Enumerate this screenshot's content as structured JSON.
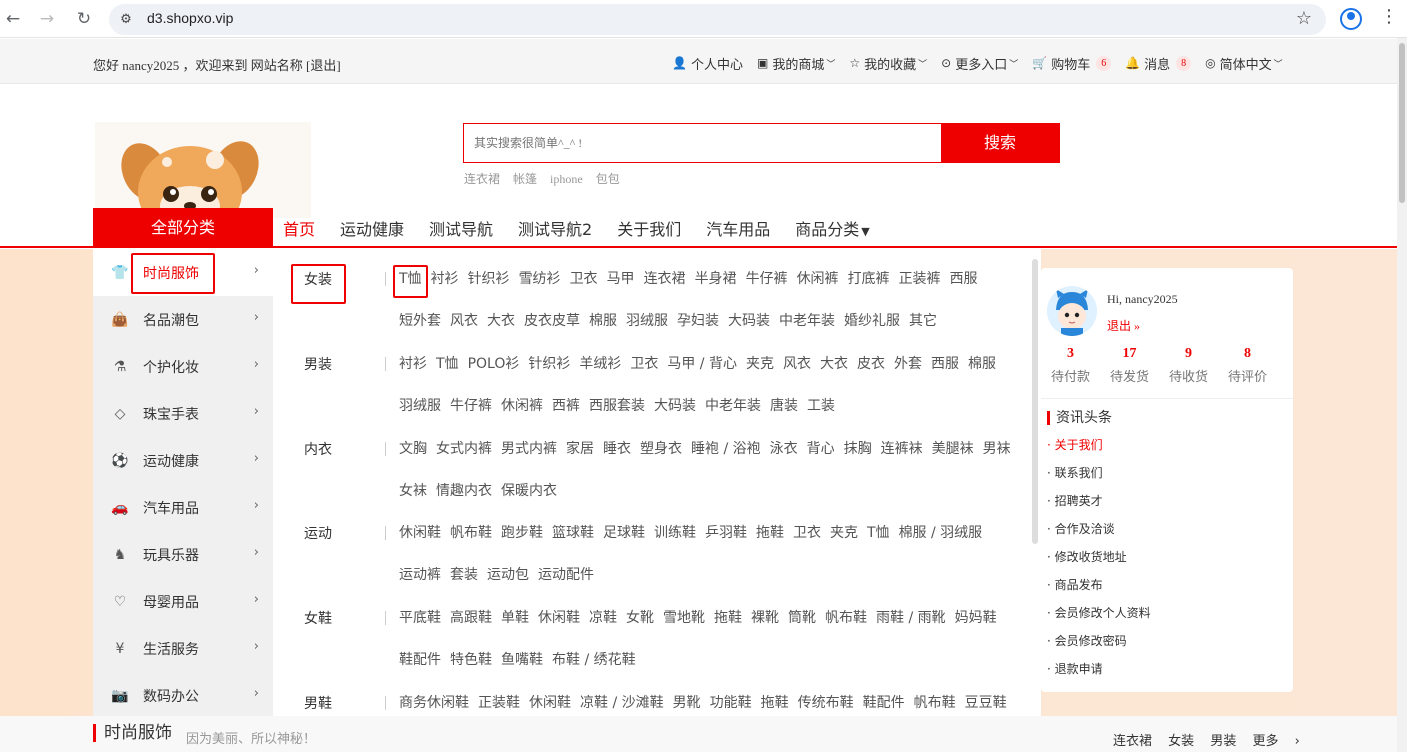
{
  "browser": {
    "url": "d3.shopxo.vip"
  },
  "topbar": {
    "greeting": "您好 nancy2025 ，欢迎来到 网站名称 [退出]",
    "links": [
      {
        "label": "个人中心",
        "icon": "user-icon",
        "caret": false
      },
      {
        "label": "我的商城",
        "icon": "shop-icon",
        "caret": true
      },
      {
        "label": "我的收藏",
        "icon": "star-icon",
        "caret": true
      },
      {
        "label": "更多入口",
        "icon": "more-icon",
        "caret": true
      },
      {
        "label": "购物车",
        "icon": "cart-icon",
        "caret": false,
        "badge": "6"
      },
      {
        "label": "消息",
        "icon": "bell-icon",
        "caret": false,
        "badge": "8"
      },
      {
        "label": "简体中文",
        "icon": "language-icon",
        "caret": true
      }
    ]
  },
  "search": {
    "placeholder": "其实搜索很简单^_^ !",
    "button": "搜索",
    "hot_words": [
      "连衣裙",
      "帐篷",
      "iphone",
      "包包"
    ]
  },
  "nav": {
    "all_categories": "全部分类",
    "items": [
      "首页",
      "运动健康",
      "测试导航",
      "测试导航2",
      "关于我们",
      "汽车用品",
      "商品分类"
    ],
    "active": "首页"
  },
  "sidebar": {
    "items": [
      {
        "label": "时尚服饰",
        "icon": "shirt-icon"
      },
      {
        "label": "名品潮包",
        "icon": "bag-icon"
      },
      {
        "label": "个护化妆",
        "icon": "cosmetics-icon"
      },
      {
        "label": "珠宝手表",
        "icon": "diamond-icon"
      },
      {
        "label": "运动健康",
        "icon": "sport-icon"
      },
      {
        "label": "汽车用品",
        "icon": "car-icon"
      },
      {
        "label": "玩具乐器",
        "icon": "toy-icon"
      },
      {
        "label": "母婴用品",
        "icon": "baby-icon"
      },
      {
        "label": "生活服务",
        "icon": "service-icon"
      },
      {
        "label": "数码办公",
        "icon": "camera-icon"
      }
    ]
  },
  "megamenu": {
    "rows": [
      {
        "label": "女装",
        "items": [
          "T恤",
          "衬衫",
          "针织衫",
          "雪纺衫",
          "卫衣",
          "马甲",
          "连衣裙",
          "半身裙",
          "牛仔裤",
          "休闲裤",
          "打底裤",
          "正装裤",
          "西服",
          "短外套",
          "风衣",
          "大衣",
          "皮衣皮草",
          "棉服",
          "羽绒服",
          "孕妇装",
          "大码装",
          "中老年装",
          "婚纱礼服",
          "其它"
        ]
      },
      {
        "label": "男装",
        "items": [
          "衬衫",
          "T恤",
          "POLO衫",
          "针织衫",
          "羊绒衫",
          "卫衣",
          "马甲 / 背心",
          "夹克",
          "风衣",
          "大衣",
          "皮衣",
          "外套",
          "西服",
          "棉服",
          "羽绒服",
          "牛仔裤",
          "休闲裤",
          "西裤",
          "西服套装",
          "大码装",
          "中老年装",
          "唐装",
          "工装"
        ]
      },
      {
        "label": "内衣",
        "items": [
          "文胸",
          "女式内裤",
          "男式内裤",
          "家居",
          "睡衣",
          "塑身衣",
          "睡袍 / 浴袍",
          "泳衣",
          "背心",
          "抹胸",
          "连裤袜",
          "美腿袜",
          "男袜",
          "女袜",
          "情趣内衣",
          "保暖内衣"
        ]
      },
      {
        "label": "运动",
        "items": [
          "休闲鞋",
          "帆布鞋",
          "跑步鞋",
          "篮球鞋",
          "足球鞋",
          "训练鞋",
          "乒羽鞋",
          "拖鞋",
          "卫衣",
          "夹克",
          "T恤",
          "棉服 / 羽绒服",
          "运动裤",
          "套装",
          "运动包",
          "运动配件"
        ]
      },
      {
        "label": "女鞋",
        "items": [
          "平底鞋",
          "高跟鞋",
          "单鞋",
          "休闲鞋",
          "凉鞋",
          "女靴",
          "雪地靴",
          "拖鞋",
          "裸靴",
          "筒靴",
          "帆布鞋",
          "雨鞋 / 雨靴",
          "妈妈鞋",
          "鞋配件",
          "特色鞋",
          "鱼嘴鞋",
          "布鞋 / 绣花鞋"
        ]
      },
      {
        "label": "男鞋",
        "items": [
          "商务休闲鞋",
          "正装鞋",
          "休闲鞋",
          "凉鞋 / 沙滩鞋",
          "男靴",
          "功能鞋",
          "拖鞋",
          "传统布鞋",
          "鞋配件",
          "帆布鞋",
          "豆豆鞋"
        ]
      }
    ]
  },
  "usercard": {
    "hi": "Hi, nancy2025",
    "logout": "退出",
    "stats": [
      {
        "num": "3",
        "label": "待付款"
      },
      {
        "num": "17",
        "label": "待发货"
      },
      {
        "num": "9",
        "label": "待收货"
      },
      {
        "num": "8",
        "label": "待评价"
      }
    ],
    "news_title": "资讯头条",
    "news": [
      "· 关于我们",
      "· 联系我们",
      "· 招聘英才",
      "· 合作及洽谈",
      "· 修改收货地址",
      "· 商品发布",
      "· 会员修改个人资料",
      "· 会员修改密码",
      "· 退款申请"
    ]
  },
  "floor": {
    "title": "时尚服饰",
    "subtitle": "因为美丽、所以神秘！",
    "links": [
      "连衣裙",
      "女装",
      "男装",
      "更多"
    ]
  },
  "colors": {
    "accent": "#e00000"
  }
}
